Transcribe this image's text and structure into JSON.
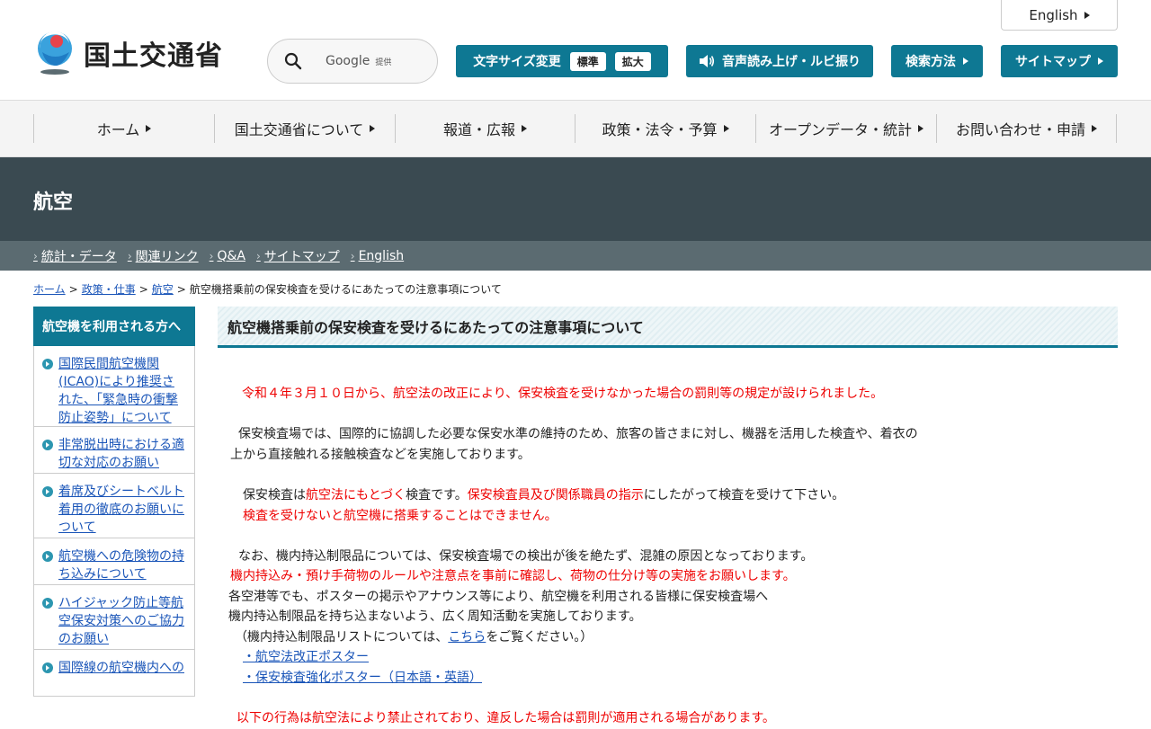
{
  "header": {
    "logo_text": "国土交通省",
    "english_label": "English",
    "search_label": "Google",
    "search_sub": "提供",
    "font_size_label": "文字サイズ変更",
    "font_standard": "標準",
    "font_large": "拡大",
    "voice_label": "音声読み上げ・ルビ振り",
    "search_method_label": "検索方法",
    "sitemap_label": "サイトマップ"
  },
  "nav": {
    "items": [
      "ホーム",
      "国土交通省について",
      "報道・広報",
      "政策・法令・予算",
      "オープンデータ・統計",
      "お問い合わせ・申請"
    ]
  },
  "section": {
    "title": "航空",
    "links": [
      "統計・データ",
      "関連リンク",
      "Q&A",
      "サイトマップ",
      "English"
    ]
  },
  "breadcrumb": {
    "home": "ホーム",
    "policy": "政策・仕事",
    "aviation": "航空",
    "sep": ">",
    "current": "航空機搭乗前の保安検査を受けるにあたっての注意事項について"
  },
  "sidebar": {
    "heading": "航空機を利用される方へ",
    "items": [
      "国際民間航空機関(ICAO)により推奨された、「緊急時の衝撃防止姿勢」について",
      "非常脱出時における適切な対応のお願い",
      "着席及びシートベルト着用の徹底のお願いについて",
      "航空機への危険物の持ち込みについて",
      "ハイジャック防止等航空保安対策へのご協力のお願い",
      "国際線の航空機内への"
    ]
  },
  "main": {
    "title": "航空機搭乗前の保安検査を受けるにあたっての注意事項について",
    "l1": "令和４年３月１０日から、航空法の改正により、保安検査を受けなかった場合の罰則等の規定が設けられました。",
    "l2": "保安検査場では、国際的に協調した必要な保安水準の維持のため、旅客の皆さまに対し、機器を活用した検査や、着衣の",
    "l3": "上から直接触れる接触検査などを実施しております。",
    "l4a": "保安検査は",
    "l4b": "航空法にもとづく",
    "l4c": "検査です。",
    "l4d": "保安検査員及び関係職員の指示",
    "l4e": "にしたがって検査を受けて下さい。",
    "l5": "検査を受けないと航空機に搭乗することはできません。",
    "l6": "なお、機内持込制限品については、保安検査場での検出が後を絶たず、混雑の原因となっております。",
    "l7": "機内持込み・預け手荷物のルールや注意点を事前に確認し、荷物の仕分け等の実施をお願いします。",
    "l8": "各空港等でも、ポスターの掲示やアナウンス等により、航空機を利用される皆様に保安検査場へ",
    "l9": "機内持込制限品を持ち込まないよう、広く周知活動を実施しております。",
    "l10a": "（機内持込制限品リストについては、",
    "l10b": "こちら",
    "l10c": "をご覧ください。）",
    "link1": "・航空法改正ポスター",
    "link2": "・保安検査強化ポスター（日本語・英語）",
    "l11": "以下の行為は航空法により禁止されており、違反した場合は罰則が適用される場合があります。"
  }
}
